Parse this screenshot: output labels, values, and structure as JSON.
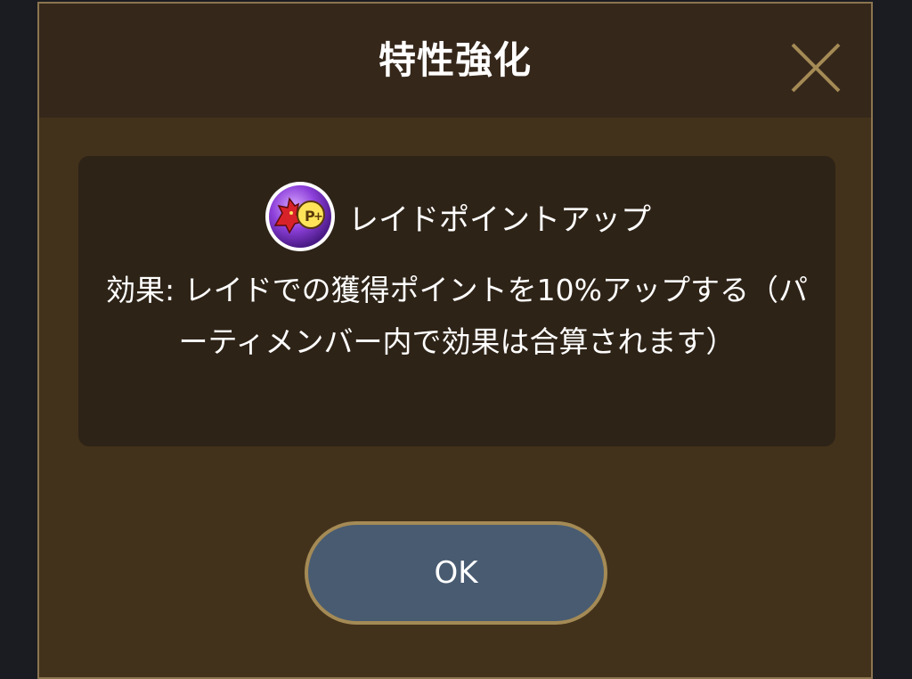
{
  "dialog": {
    "title": "特性強化",
    "close_icon": "close-x-icon"
  },
  "skill": {
    "icon": "raid-point-up-icon",
    "name": "レイドポイントアップ",
    "description": "効果: レイドでの獲得ポイントを10%アップする（パーティメンバー内で効果は合算されます）"
  },
  "ok_button": {
    "label": "OK"
  },
  "colors": {
    "background": "#1b1c21",
    "dialog_body": "#43321b",
    "dialog_header": "#35271a",
    "dialog_border": "#8b7550",
    "panel": "#2e2317",
    "button_fill": "#485b71",
    "button_border": "#a48a55",
    "close_icon": "#a48a55"
  }
}
